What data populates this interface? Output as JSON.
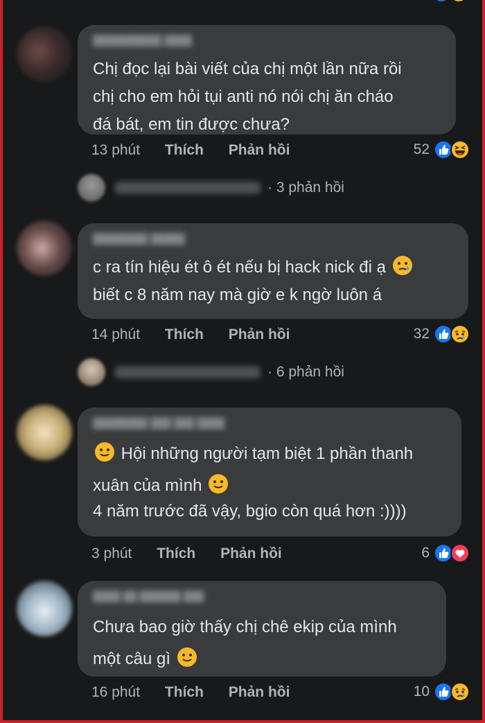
{
  "comments": [
    {
      "text_lines": [
        "Chị đọc lại bài viết của chị một lần nữa rồi",
        "chị cho em hỏi tụi anti nó nói chị ăn cháo",
        "đá bát, em tin được chưa?"
      ],
      "time": "13 phút",
      "like": "Thích",
      "reply": "Phản hồi",
      "reaction_count": "52",
      "reactions": [
        "like-icon",
        "haha-icon"
      ],
      "replies": "3 phản hồi"
    },
    {
      "text_lines": [
        "c ra tín hiệu ét ô ét nếu bị hack nick đi ạ",
        "biết c 8 năm nay mà giờ e k ngờ luôn á"
      ],
      "time": "14 phút",
      "like": "Thích",
      "reply": "Phản hồi",
      "reaction_count": "32",
      "reactions": [
        "like-icon",
        "sad-icon"
      ],
      "replies": "6 phản hồi"
    },
    {
      "text_lines": [
        "Hội những người tạm biệt 1 phần thanh",
        "xuân của mình",
        "4 năm trước đã vậy, bgio còn quá hơn :))))"
      ],
      "time": "3 phút",
      "like": "Thích",
      "reply": "Phản hồi",
      "reaction_count": "6",
      "reactions": [
        "like-icon",
        "love-icon"
      ]
    },
    {
      "text_lines": [
        "Chưa bao giờ thấy chị chê ekip của mình",
        "một câu gì"
      ],
      "time": "16 phút",
      "like": "Thích",
      "reply": "Phản hồi",
      "reaction_count": "10",
      "reactions": [
        "like-icon",
        "sad-icon"
      ]
    }
  ],
  "colors": {
    "background": "#18191a",
    "bubble": "#3a3b3c",
    "text": "#e4e6eb",
    "meta": "#b0b3b8",
    "like_blue": "#1877f2",
    "border_red": "#d0202a"
  }
}
